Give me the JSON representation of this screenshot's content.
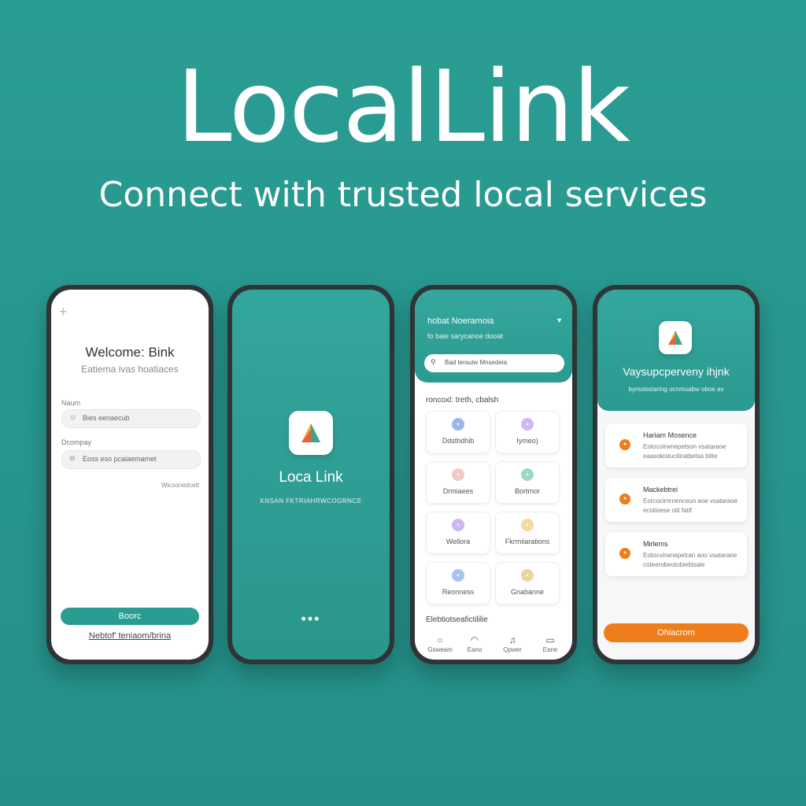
{
  "hero": {
    "title": "LocalLink",
    "subtitle": "Connect with trusted local services"
  },
  "colors": {
    "primary": "#2a9d93",
    "accent": "#ef7d1a"
  },
  "screen_login": {
    "title": "Welcome: Bink",
    "subtitle": "Eatiema ivas hoatiaces",
    "fields": [
      {
        "label": "Naum",
        "value": "Bies eenaecub",
        "icon": "user-icon"
      },
      {
        "label": "Dcompay",
        "value": "Eoss eso pcaiaemamet",
        "icon": "lock-icon"
      }
    ],
    "forgot": "Wicsonedcett",
    "button": "Boorc",
    "link": "Nebtof' teniaom/brina"
  },
  "screen_splash": {
    "name": "Loca Link",
    "tagline": "KNSAN FKTRIAHRWCOGRNCE",
    "loading": "•••"
  },
  "screen_home": {
    "greeting": "hobat Noeramoia",
    "location": "fo baie sarycanoe dooat",
    "search": "Bad terauiw Mnsedeia",
    "section_title": "roncoxl: treth, cbalsh",
    "categories": [
      {
        "label": "Ddsthdhib",
        "color": "#9bb7ea",
        "icon": "home-icon"
      },
      {
        "label": "Iymeo)",
        "color": "#d7b7f0",
        "icon": "tools-icon"
      },
      {
        "label": "Drmiaees",
        "color": "#f3c9c6",
        "icon": "paint-icon"
      },
      {
        "label": "Bortmor",
        "color": "#9fd6c8",
        "icon": "leaf-icon"
      },
      {
        "label": "Wellora",
        "color": "#cdb6f2",
        "icon": "heart-icon"
      },
      {
        "label": "Fkrmiiarations",
        "color": "#f5d9a1",
        "icon": "star-icon"
      },
      {
        "label": "Reonness",
        "color": "#a9c3ec",
        "icon": "drop-icon"
      },
      {
        "label": "Gnabanne",
        "color": "#f3cfa8",
        "icon": "car-icon"
      }
    ],
    "bottom_title": "Elebtiotseafictililie",
    "nav": [
      {
        "label": "Gsweam",
        "icon": "home-nav-icon"
      },
      {
        "label": "Eano",
        "icon": "search-nav-icon"
      },
      {
        "label": "Qpwer",
        "icon": "calendar-nav-icon"
      },
      {
        "label": "Eane",
        "icon": "profile-nav-icon"
      }
    ]
  },
  "screen_providers": {
    "title": "Vaysupcperveny ihjnk",
    "subtitle": "bymolsstaring ocnmuabw oboe av",
    "cards": [
      {
        "title": "Hariam Mosence",
        "line1": "Eotocoirwnepetson vsataraoe",
        "line2": "eaasokistucitiratbetsa bitte"
      },
      {
        "title": "Mackebtrei",
        "line1": "Eorcocirnrnenceuo aoe vsataraoe",
        "line2": "ecotioese oiti fatif"
      },
      {
        "title": "Mirlems",
        "line1": "Eotocvirwnepetran aoo vsataraoe",
        "line2": "coteerobeotobieblsale"
      }
    ],
    "button": "Ohiacrom"
  }
}
